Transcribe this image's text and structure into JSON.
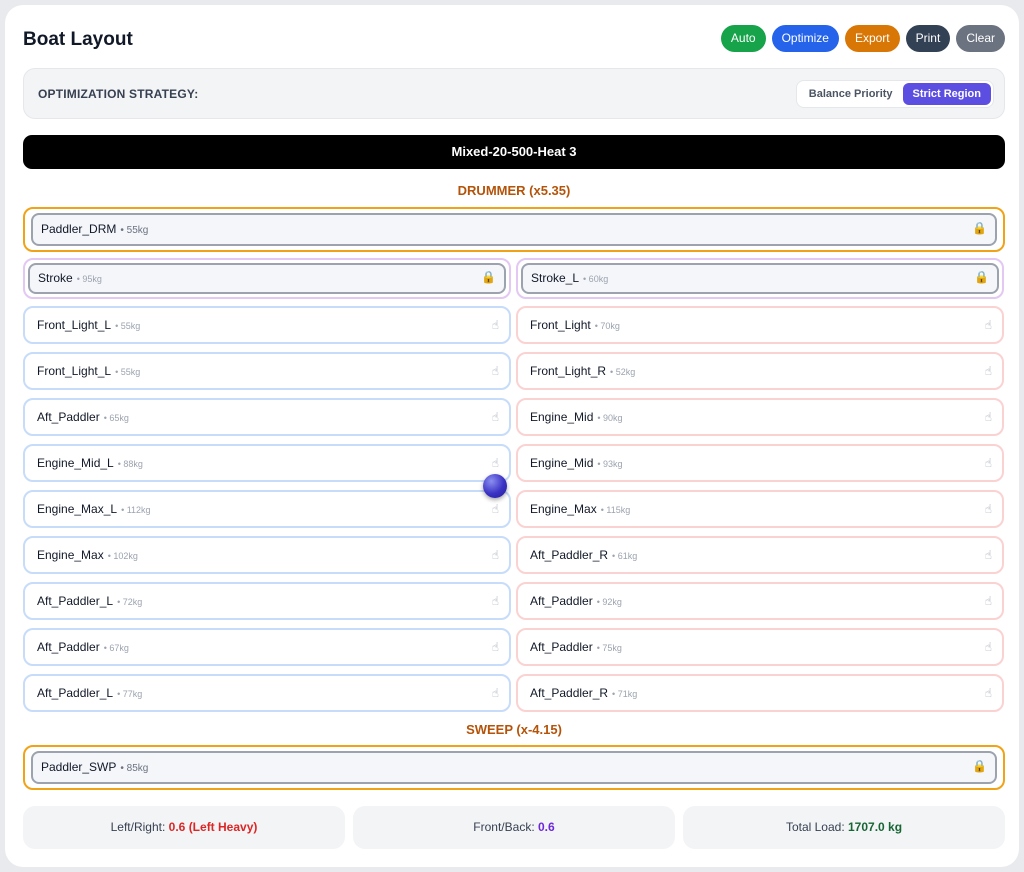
{
  "header": {
    "title": "Boat Layout",
    "buttons": [
      {
        "label": "Auto",
        "color": "#16a34a"
      },
      {
        "label": "Optimize",
        "color": "#2563eb"
      },
      {
        "label": "Export",
        "color": "#d97706"
      },
      {
        "label": "Print",
        "color": "#334155"
      },
      {
        "label": "Clear",
        "color": "#6b7280"
      }
    ]
  },
  "strategy": {
    "label": "OPTIMIZATION STRATEGY:",
    "options": [
      "Balance Priority",
      "Strict Region"
    ],
    "selected": "Strict Region"
  },
  "race_title": "Mixed-20-500-Heat 3",
  "drummer": {
    "label": "DRUMMER (x5.35)",
    "name": "Paddler_DRM",
    "weight": "• 55kg",
    "icon": "lock-icon"
  },
  "stroke": {
    "left": {
      "name": "Stroke",
      "weight": "• 95kg",
      "icon": "lock-icon"
    },
    "right": {
      "name": "Stroke_L",
      "weight": "• 60kg",
      "icon": "lock-icon"
    }
  },
  "rows": [
    {
      "left": {
        "name": "Front_Light_L",
        "weight": "• 55kg"
      },
      "right": {
        "name": "Front_Light",
        "weight": "• 70kg"
      }
    },
    {
      "left": {
        "name": "Front_Light_L",
        "weight": "• 55kg"
      },
      "right": {
        "name": "Front_Light_R",
        "weight": "• 52kg"
      }
    },
    {
      "left": {
        "name": "Aft_Paddler",
        "weight": "• 65kg"
      },
      "right": {
        "name": "Engine_Mid",
        "weight": "• 90kg"
      }
    },
    {
      "left": {
        "name": "Engine_Mid_L",
        "weight": "• 88kg"
      },
      "right": {
        "name": "Engine_Mid",
        "weight": "• 93kg"
      }
    },
    {
      "left": {
        "name": "Engine_Max_L",
        "weight": "• 112kg"
      },
      "right": {
        "name": "Engine_Max",
        "weight": "• 115kg"
      }
    },
    {
      "left": {
        "name": "Engine_Max",
        "weight": "• 102kg"
      },
      "right": {
        "name": "Aft_Paddler_R",
        "weight": "• 61kg"
      }
    },
    {
      "left": {
        "name": "Aft_Paddler_L",
        "weight": "• 72kg"
      },
      "right": {
        "name": "Aft_Paddler",
        "weight": "• 92kg"
      }
    },
    {
      "left": {
        "name": "Aft_Paddler",
        "weight": "• 67kg"
      },
      "right": {
        "name": "Aft_Paddler",
        "weight": "• 75kg"
      }
    },
    {
      "left": {
        "name": "Aft_Paddler_L",
        "weight": "• 77kg"
      },
      "right": {
        "name": "Aft_Paddler_R",
        "weight": "• 71kg"
      }
    }
  ],
  "seat_icon": "hand-icon",
  "sweep": {
    "label": "SWEEP (x-4.15)",
    "name": "Paddler_SWP",
    "weight": "• 85kg",
    "icon": "lock-icon"
  },
  "stats": {
    "left_right": {
      "label": "Left/Right:",
      "value": "0.6 (Left Heavy)",
      "color": "#dc2626"
    },
    "front_back": {
      "label": "Front/Back:",
      "value": "0.6",
      "color": "#6d28d9"
    },
    "total": {
      "label": "Total Load:",
      "value": "1707.0 kg",
      "color": "#166534"
    }
  }
}
